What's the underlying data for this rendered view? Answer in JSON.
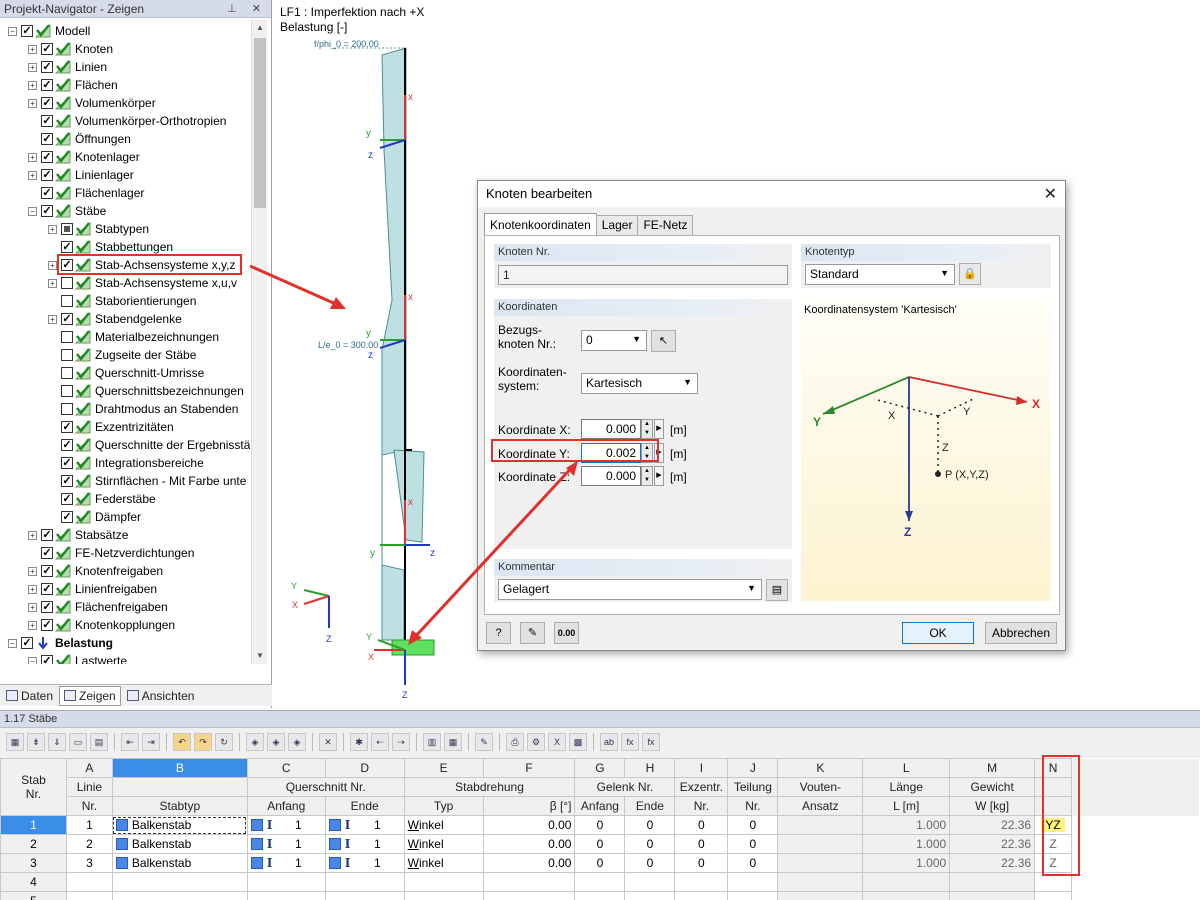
{
  "nav": {
    "title": "Projekt-Navigator - Zeigen",
    "items": [
      {
        "label": "Modell",
        "expander": "-",
        "check": "checked",
        "indent": 0
      },
      {
        "label": "Knoten",
        "expander": "+",
        "check": "checked",
        "indent": 1
      },
      {
        "label": "Linien",
        "expander": "+",
        "check": "checked",
        "indent": 1
      },
      {
        "label": "Flächen",
        "expander": "+",
        "check": "checked",
        "indent": 1
      },
      {
        "label": "Volumenkörper",
        "expander": "+",
        "check": "checked",
        "indent": 1
      },
      {
        "label": "Volumenkörper-Orthotropien",
        "expander": "",
        "check": "checked",
        "indent": 1
      },
      {
        "label": "Öffnungen",
        "expander": "",
        "check": "checked",
        "indent": 1
      },
      {
        "label": "Knotenlager",
        "expander": "+",
        "check": "checked",
        "indent": 1
      },
      {
        "label": "Linienlager",
        "expander": "+",
        "check": "checked",
        "indent": 1
      },
      {
        "label": "Flächenlager",
        "expander": "",
        "check": "checked",
        "indent": 1
      },
      {
        "label": "Stäbe",
        "expander": "-",
        "check": "checked",
        "indent": 1
      },
      {
        "label": "Stabtypen",
        "expander": "+",
        "check": "partial",
        "indent": 2
      },
      {
        "label": "Stabbettungen",
        "expander": "",
        "check": "checked",
        "indent": 2
      },
      {
        "label": "Stab-Achsensysteme x,y,z",
        "expander": "+",
        "check": "checked",
        "indent": 2
      },
      {
        "label": "Stab-Achsensysteme x,u,v",
        "expander": "+",
        "check": "unchecked",
        "indent": 2
      },
      {
        "label": "Staborientierungen",
        "expander": "",
        "check": "unchecked",
        "indent": 2
      },
      {
        "label": "Stabendgelenke",
        "expander": "+",
        "check": "checked",
        "indent": 2
      },
      {
        "label": "Materialbezeichnungen",
        "expander": "",
        "check": "unchecked",
        "indent": 2
      },
      {
        "label": "Zugseite der Stäbe",
        "expander": "",
        "check": "unchecked",
        "indent": 2
      },
      {
        "label": "Querschnitt-Umrisse",
        "expander": "",
        "check": "unchecked",
        "indent": 2
      },
      {
        "label": "Querschnittsbezeichnungen",
        "expander": "",
        "check": "unchecked",
        "indent": 2
      },
      {
        "label": "Drahtmodus an Stabenden",
        "expander": "",
        "check": "unchecked",
        "indent": 2
      },
      {
        "label": "Exzentrizitäten",
        "expander": "",
        "check": "checked",
        "indent": 2
      },
      {
        "label": "Querschnitte der Ergebnisstä",
        "expander": "",
        "check": "checked",
        "indent": 2
      },
      {
        "label": "Integrationsbereiche",
        "expander": "",
        "check": "checked",
        "indent": 2
      },
      {
        "label": "Stirnflächen - Mit Farbe unte",
        "expander": "",
        "check": "checked",
        "indent": 2
      },
      {
        "label": "Federstäbe",
        "expander": "",
        "check": "checked",
        "indent": 2
      },
      {
        "label": "Dämpfer",
        "expander": "",
        "check": "checked",
        "indent": 2
      },
      {
        "label": "Stabsätze",
        "expander": "+",
        "check": "checked",
        "indent": 1
      },
      {
        "label": "FE-Netzverdichtungen",
        "expander": "",
        "check": "checked",
        "indent": 1
      },
      {
        "label": "Knotenfreigaben",
        "expander": "+",
        "check": "checked",
        "indent": 1
      },
      {
        "label": "Linienfreigaben",
        "expander": "+",
        "check": "checked",
        "indent": 1
      },
      {
        "label": "Flächenfreigaben",
        "expander": "+",
        "check": "checked",
        "indent": 1
      },
      {
        "label": "Knotenkopplungen",
        "expander": "+",
        "check": "checked",
        "indent": 1
      },
      {
        "label": "Belastung",
        "expander": "-",
        "check": "checked",
        "indent": 0,
        "bold": true
      },
      {
        "label": "Lastwerte",
        "expander": "-",
        "check": "checked",
        "indent": 1
      }
    ],
    "tabs": {
      "daten": "Daten",
      "zeigen": "Zeigen",
      "ansichten": "Ansichten"
    }
  },
  "view": {
    "line1": "LF1 : Imperfektion nach +X",
    "line2": "Belastung [-]",
    "label_phi": "f/phi_0 = 200.00",
    "label_le": "L/e_0 = 300.00",
    "axes": {
      "x": "x",
      "y": "y",
      "z": "z",
      "X": "X",
      "Y": "Y",
      "Z": "Z"
    }
  },
  "dialog": {
    "title": "Knoten bearbeiten",
    "close": "✕",
    "tabs": [
      "Knotenkoordinaten",
      "Lager",
      "FE-Netz"
    ],
    "knoten_nr": {
      "header": "Knoten Nr.",
      "value": "1"
    },
    "knotentyp": {
      "header": "Knotentyp",
      "value": "Standard"
    },
    "koordinaten": {
      "header": "Koordinaten",
      "bezug_label_1": "Bezugs-",
      "bezug_label_2": "knoten Nr.:",
      "bezug_value": "0",
      "system_label_1": "Koordinaten-",
      "system_label_2": "system:",
      "system_value": "Kartesisch",
      "x_label": "Koordinate X:",
      "x_value": "0.000",
      "y_label": "Koordinate Y:",
      "y_value": "0.002",
      "z_label": "Koordinate Z:",
      "z_value": "0.000",
      "unit": "[m]"
    },
    "preview": {
      "title": "Koordinatensystem 'Kartesisch'",
      "X": "X",
      "Y": "Y",
      "Z": "Z",
      "x_small": "X",
      "y_small": "Y",
      "z_small": "Z",
      "point": "P (X,Y,Z)"
    },
    "kommentar": {
      "header": "Kommentar",
      "value": "Gelagert"
    },
    "ok": "OK",
    "cancel": "Abbrechen",
    "icon_value": "0.00"
  },
  "table": {
    "title": "1.17 Stäbe",
    "col_letters": [
      "A",
      "B",
      "C",
      "D",
      "E",
      "F",
      "G",
      "H",
      "I",
      "J",
      "K",
      "L",
      "M",
      "N"
    ],
    "header1": {
      "stab": "Stab",
      "linie": "Linie",
      "qs": "Querschnitt Nr.",
      "stabdrehung": "Stabdrehung",
      "gelenk": "Gelenk Nr.",
      "exzentr": "Exzentr.",
      "teilung": "Teilung",
      "vouten": "Vouten-",
      "laenge": "Länge",
      "gewicht": "Gewicht"
    },
    "header2": {
      "nr": "Nr.",
      "linie_nr": "Nr.",
      "stabtyp": "Stabtyp",
      "anfang": "Anfang",
      "ende": "Ende",
      "typ": "Typ",
      "beta": "β [°]",
      "g_anfang": "Anfang",
      "g_ende": "Ende",
      "ex_nr": "Nr.",
      "t_nr": "Nr.",
      "ansatz": "Ansatz",
      "l": "L [m]",
      "w": "W [kg]"
    },
    "rows": [
      {
        "nr": "1",
        "linie": "1",
        "typ": "Balkenstab",
        "qa": "1",
        "qe": "1",
        "dreh": "Winkel",
        "beta": "0.00",
        "ga": "0",
        "ge": "0",
        "ex": "0",
        "teil": "0",
        "l": "1.000",
        "w": "22.36",
        "n": "YZ"
      },
      {
        "nr": "2",
        "linie": "2",
        "typ": "Balkenstab",
        "qa": "1",
        "qe": "1",
        "dreh": "Winkel",
        "beta": "0.00",
        "ga": "0",
        "ge": "0",
        "ex": "0",
        "teil": "0",
        "l": "1.000",
        "w": "22.36",
        "n": "Z"
      },
      {
        "nr": "3",
        "linie": "3",
        "typ": "Balkenstab",
        "qa": "1",
        "qe": "1",
        "dreh": "Winkel",
        "beta": "0.00",
        "ga": "0",
        "ge": "0",
        "ex": "0",
        "teil": "0",
        "l": "1.000",
        "w": "22.36",
        "n": "Z"
      }
    ],
    "extra_rows": [
      "4",
      "5"
    ]
  },
  "colors": {
    "accent_red": "#e0312b",
    "selection_blue": "#3a8ee6",
    "highlight_yellow": "#fff57a"
  }
}
